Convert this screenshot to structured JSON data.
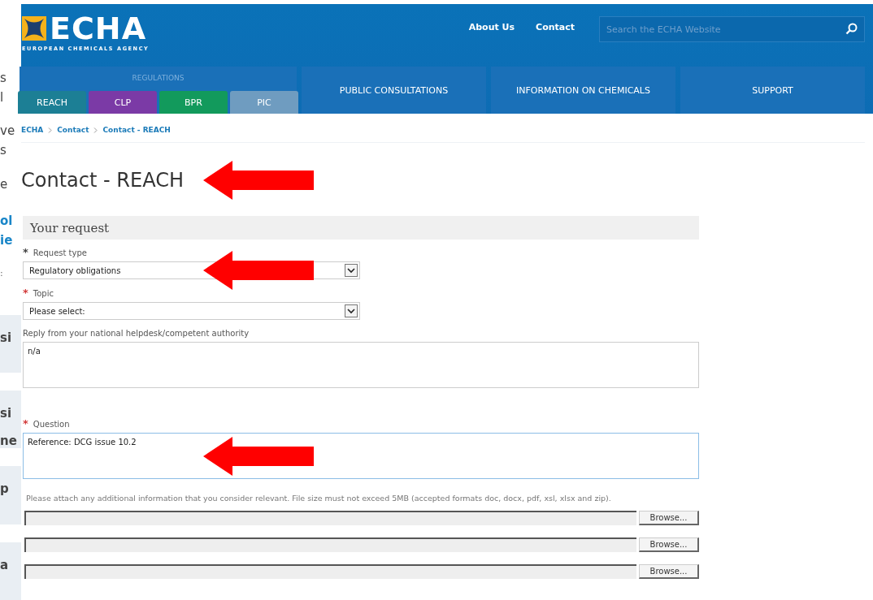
{
  "background_page": {
    "blocks": [
      {
        "kind": "text",
        "lines": [
          "s",
          "l"
        ]
      },
      {
        "kind": "text",
        "lines": [
          "ve",
          "s"
        ]
      },
      {
        "kind": "text",
        "lines": [
          "e"
        ]
      },
      {
        "kind": "link",
        "lines": [
          "ol",
          "ie"
        ]
      },
      {
        "kind": "note",
        "lines": [
          ":"
        ]
      },
      {
        "kind": "panel",
        "lines": [
          "si"
        ]
      },
      {
        "kind": "panel",
        "lines": [
          "si",
          "ne"
        ]
      },
      {
        "kind": "panel",
        "lines": [
          "p"
        ]
      },
      {
        "kind": "panel",
        "lines": [
          "a"
        ]
      }
    ]
  },
  "header": {
    "logo": {
      "wordmark": "ECHA",
      "tagline": "EUROPEAN CHEMICALS AGENCY"
    },
    "links": [
      "About Us",
      "Contact"
    ],
    "search": {
      "placeholder": "Search the ECHA Website"
    }
  },
  "nav": {
    "group_label": "REGULATIONS",
    "tabs": [
      {
        "label": "REACH",
        "color": "#1c7f95"
      },
      {
        "label": "CLP",
        "color": "#7b3aa6"
      },
      {
        "label": "BPR",
        "color": "#129a5c"
      },
      {
        "label": "PIC",
        "color": "#6f9cc0"
      }
    ],
    "items": [
      "PUBLIC CONSULTATIONS",
      "INFORMATION ON CHEMICALS",
      "SUPPORT"
    ]
  },
  "breadcrumb": [
    "ECHA",
    "Contact",
    "Contact - REACH"
  ],
  "title": {
    "text": "Contact - REACH",
    "arrow": true
  },
  "section": "Your request",
  "fields": [
    {
      "kind": "select",
      "label": "Request type",
      "marker": "*",
      "color": "#444444",
      "value": "Regulatory obligations",
      "arrow": true
    },
    {
      "kind": "select",
      "label": "Topic",
      "marker": "*",
      "color": "#d23a3a",
      "value": "Please select:",
      "arrow": false
    },
    {
      "kind": "textarea",
      "label": "Reply from your national helpdesk/competent authority",
      "value": "n/a",
      "focused": false,
      "arrow": false
    },
    {
      "kind": "textarea",
      "label": "Question",
      "marker": "*",
      "color": "#d23a3a",
      "value": "Reference: DCG issue 10.2",
      "focused": true,
      "arrow": true
    }
  ],
  "attachments": {
    "help": "Please attach any additional information that you consider relevant. File size must not exceed 5MB (accepted formats doc, docx, pdf, xsl, xlsx and zip).",
    "rows": [
      {
        "button": "Browse..."
      },
      {
        "button": "Browse..."
      },
      {
        "button": "Browse..."
      }
    ]
  }
}
